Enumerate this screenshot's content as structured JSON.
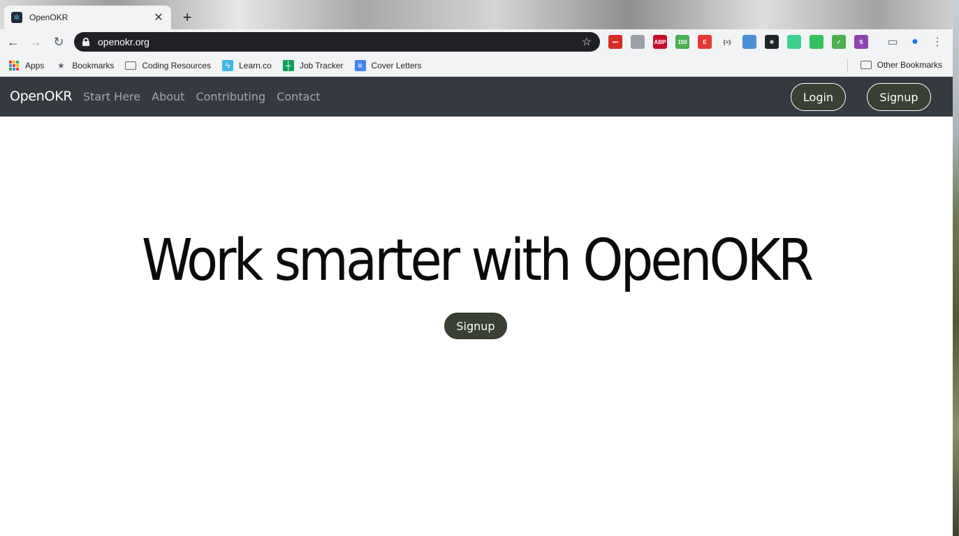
{
  "browser": {
    "tab_title": "OpenOKR",
    "url": "openokr.org",
    "bookmarks": [
      {
        "label": "Apps",
        "icon": "apps-grid-icon"
      },
      {
        "label": "Bookmarks",
        "icon": "star-icon"
      },
      {
        "label": "Coding Resources",
        "icon": "folder-icon"
      },
      {
        "label": "Learn.co",
        "icon": "lightning-icon"
      },
      {
        "label": "Job Tracker",
        "icon": "sheets-icon"
      },
      {
        "label": "Cover Letters",
        "icon": "docs-icon"
      }
    ],
    "other_bookmarks": "Other Bookmarks",
    "extensions": [
      {
        "name": "lastpass-icon",
        "label": "•••",
        "color": "#d32d27"
      },
      {
        "name": "pocket-icon",
        "label": "",
        "color": "#9aa0a6"
      },
      {
        "name": "adblock-plus-icon",
        "label": "ABP",
        "color": "#c70d2c"
      },
      {
        "name": "counter-icon",
        "label": "150",
        "color": "#4caf50"
      },
      {
        "name": "e-extension-icon",
        "label": "E",
        "color": "#e53935"
      },
      {
        "name": "json-viewer-icon",
        "label": "{≡}",
        "color": "#f1f3f4"
      },
      {
        "name": "ring-icon",
        "label": "",
        "color": "#4a90d9"
      },
      {
        "name": "react-devtools-icon",
        "label": "⚛",
        "color": "#20232a"
      },
      {
        "name": "target-icon",
        "label": "",
        "color": "#3ecf8e"
      },
      {
        "name": "green-badge-icon",
        "label": "",
        "color": "#36c05d"
      },
      {
        "name": "check-icon",
        "label": "✓",
        "color": "#4caf50"
      },
      {
        "name": "s-extension-icon",
        "label": "S",
        "color": "#8e44ad"
      }
    ]
  },
  "site": {
    "brand": "OpenOKR",
    "nav": [
      "Start Here",
      "About",
      "Contributing",
      "Contact"
    ],
    "login_label": "Login",
    "signup_label": "Signup"
  },
  "hero": {
    "title": "Work smarter with OpenOKR",
    "cta_label": "Signup"
  }
}
